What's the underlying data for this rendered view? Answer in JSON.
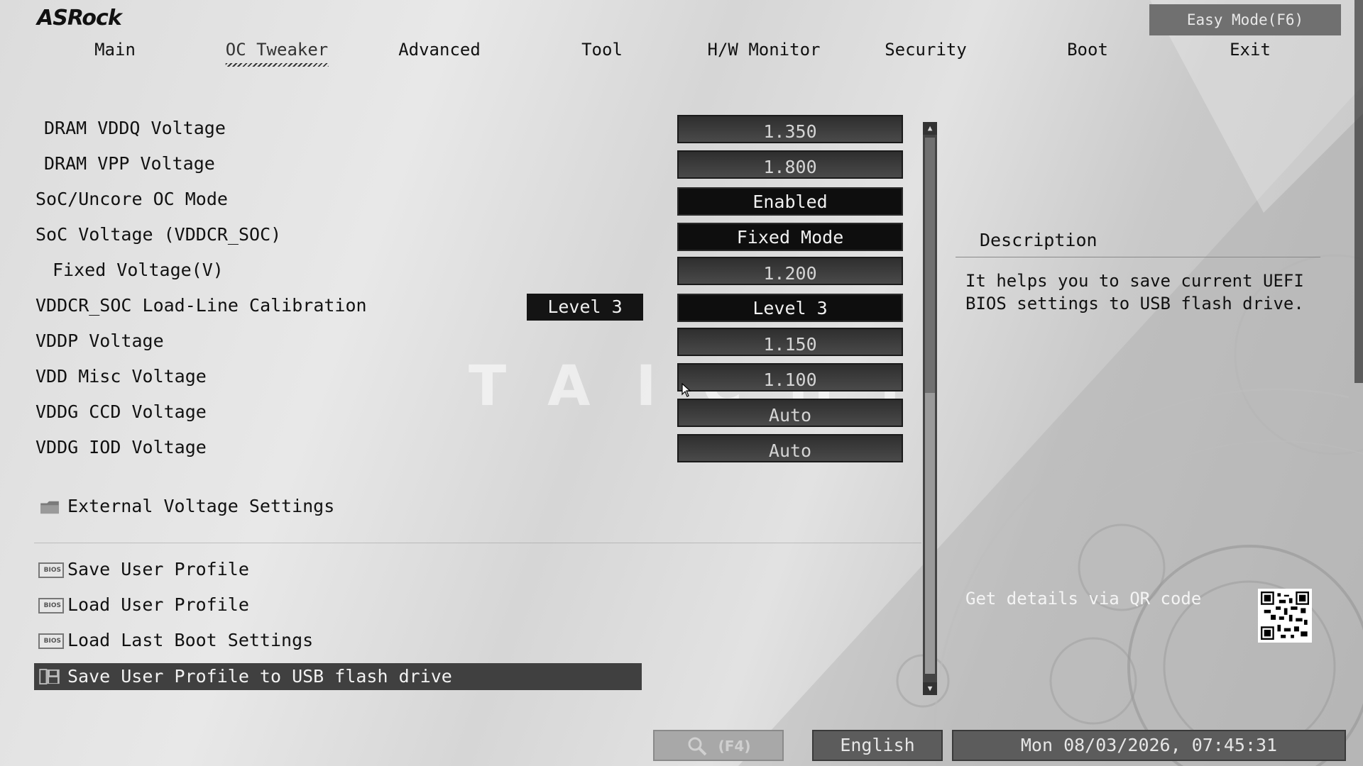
{
  "brand": "ASRock",
  "easy_mode_label": "Easy Mode(F6)",
  "watermark": "TAICHI",
  "tabs": [
    {
      "label": "Main"
    },
    {
      "label": "OC Tweaker"
    },
    {
      "label": "Advanced"
    },
    {
      "label": "Tool"
    },
    {
      "label": "H/W Monitor"
    },
    {
      "label": "Security"
    },
    {
      "label": "Boot"
    },
    {
      "label": "Exit"
    }
  ],
  "active_tab": "OC Tweaker",
  "settings": [
    {
      "label": "DRAM VDDQ Voltage",
      "value": "1.350"
    },
    {
      "label": "DRAM VPP Voltage",
      "value": "1.800"
    },
    {
      "label": "SoC/Uncore OC Mode",
      "value": "Enabled"
    },
    {
      "label": "SoC Voltage (VDDCR_SOC)",
      "value": "Fixed Mode"
    },
    {
      "label": "Fixed Voltage(V)",
      "value": "1.200"
    },
    {
      "label": "VDDCR_SOC Load-Line Calibration",
      "value": "Level 3",
      "current": "Level 3"
    },
    {
      "label": "VDDP Voltage",
      "value": "1.150"
    },
    {
      "label": "VDD Misc Voltage",
      "value": "1.100"
    },
    {
      "label": "VDDG CCD Voltage",
      "value": "Auto"
    },
    {
      "label": "VDDG IOD Voltage",
      "value": "Auto"
    }
  ],
  "submenu": {
    "label": "External Voltage Settings",
    "icon": "folder-icon"
  },
  "profile_items": [
    {
      "label": "Save User Profile",
      "icon": "bios-icon"
    },
    {
      "label": "Load User Profile",
      "icon": "bios-icon"
    },
    {
      "label": "Load Last Boot Settings",
      "icon": "bios-icon"
    },
    {
      "label": "Save User Profile to USB flash drive",
      "icon": "floppy-icon"
    }
  ],
  "description": {
    "title": "Description",
    "text_line1": "It helps you to save current UEFI",
    "text_line2": "BIOS settings to USB flash drive."
  },
  "qr_text": "Get details via QR code",
  "footer": {
    "search_label": "(F4)",
    "language": "English",
    "datetime": "Mon 08/03/2026, 07:45:31"
  }
}
